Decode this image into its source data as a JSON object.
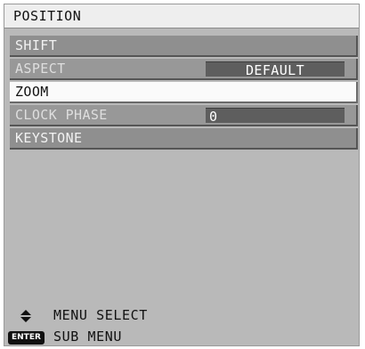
{
  "title": "POSITION",
  "menu": {
    "items": [
      {
        "label": "SHIFT",
        "value": ""
      },
      {
        "label": "ASPECT",
        "value": "DEFAULT"
      },
      {
        "label": "ZOOM",
        "value": ""
      },
      {
        "label": "CLOCK PHASE",
        "value": "0"
      },
      {
        "label": "KEYSTONE",
        "value": ""
      }
    ]
  },
  "footer": {
    "menu_select": "MENU SELECT",
    "sub_menu": "SUB MENU",
    "enter_key_label": "ENTER"
  },
  "colors": {
    "frame_bg": "#b9b9b9",
    "row_bg": "#8f8f8f",
    "selected_row_bg": "#fafafa",
    "value_box_bg": "#5e5e5e"
  }
}
